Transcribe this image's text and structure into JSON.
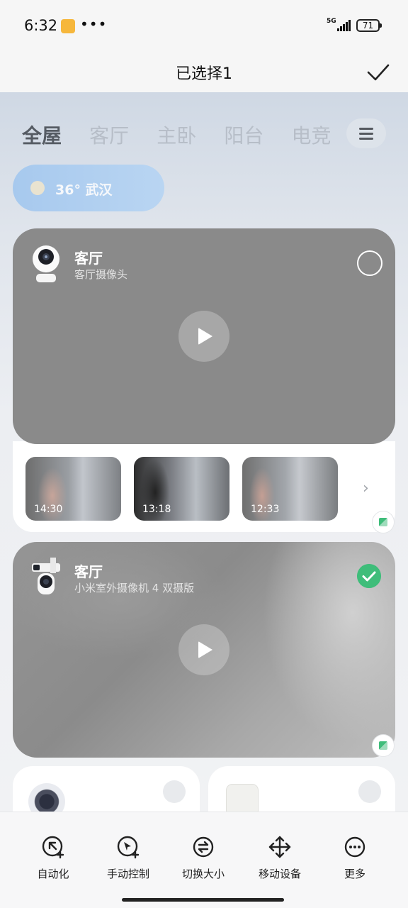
{
  "status_bar": {
    "time": "6:32",
    "notification_icon": "app-notification-icon",
    "overflow": "•••",
    "network": "5G",
    "battery": "71"
  },
  "header": {
    "title": "已选择1",
    "confirm_icon": "checkmark-icon"
  },
  "tabs": {
    "items": [
      {
        "label": "全屋",
        "active": true
      },
      {
        "label": "客厅",
        "active": false
      },
      {
        "label": "主卧",
        "active": false
      },
      {
        "label": "阳台",
        "active": false
      },
      {
        "label": "电竞",
        "active": false
      }
    ],
    "menu_icon": "hamburger-icon"
  },
  "weather": {
    "text": "36° 武汉",
    "icon": "sun-icon"
  },
  "cameras": [
    {
      "room": "客厅",
      "device": "客厅摄像头",
      "selected": false,
      "clips": [
        "14:30",
        "13:18",
        "12:33"
      ]
    },
    {
      "room": "客厅",
      "device": "小米室外摄像机 4 双摄版",
      "selected": true
    }
  ],
  "colors": {
    "accent_green": "#3fbd7a",
    "weather_blue": "#a7c9ee",
    "card_gray": "#8a8a8a"
  },
  "bottom_actions": [
    {
      "label": "自动化",
      "icon": "automation-icon"
    },
    {
      "label": "手动控制",
      "icon": "manual-control-icon"
    },
    {
      "label": "切换大小",
      "icon": "switch-size-icon"
    },
    {
      "label": "移动设备",
      "icon": "move-device-icon"
    },
    {
      "label": "更多",
      "icon": "more-icon"
    }
  ]
}
